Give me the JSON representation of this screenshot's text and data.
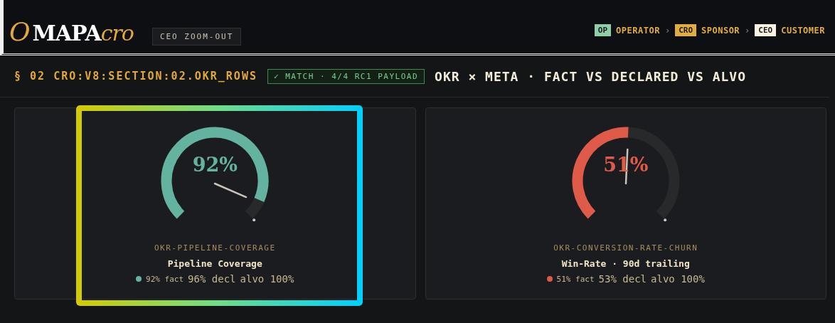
{
  "header": {
    "logo": {
      "mark": "O",
      "name": "MAPA",
      "suffix": "cro"
    },
    "view_tag": "CEO ZOOM-OUT",
    "breadcrumb": [
      {
        "badge": "OP",
        "label": "OPERATOR",
        "color": "#8ecfa8"
      },
      {
        "separator": "›",
        "badge": "CRO",
        "label": "SPONSOR",
        "color": "#e3ad3b"
      },
      {
        "separator": "›",
        "badge": "CEO",
        "label": "CUSTOMER",
        "color": "#fbf3e1"
      }
    ]
  },
  "section": {
    "id": "§ 02 CRO:V8:SECTION:02.OKR_ROWS",
    "status": "✓ MATCH · 4/4 RC1 PAYLOAD",
    "title": "OKR × META · FACT VS DECLARED VS ALVO"
  },
  "cards": [
    {
      "value": "92%",
      "color": "#63b3a0",
      "selected": true,
      "code": "OKR-PIPELINE-COVERAGE",
      "title": "Pipeline Coverage",
      "fact": "92% fact",
      "declared": "96% decl",
      "target": "alvo 100%"
    },
    {
      "value": "51%",
      "color": "#e05a4a",
      "selected": false,
      "code": "OKR-CONVERSION-RATE-CHURN",
      "title": "Win-Rate · 90d trailing",
      "fact": "51% fact",
      "declared": "53% decl",
      "target": "alvo 100%"
    }
  ]
}
